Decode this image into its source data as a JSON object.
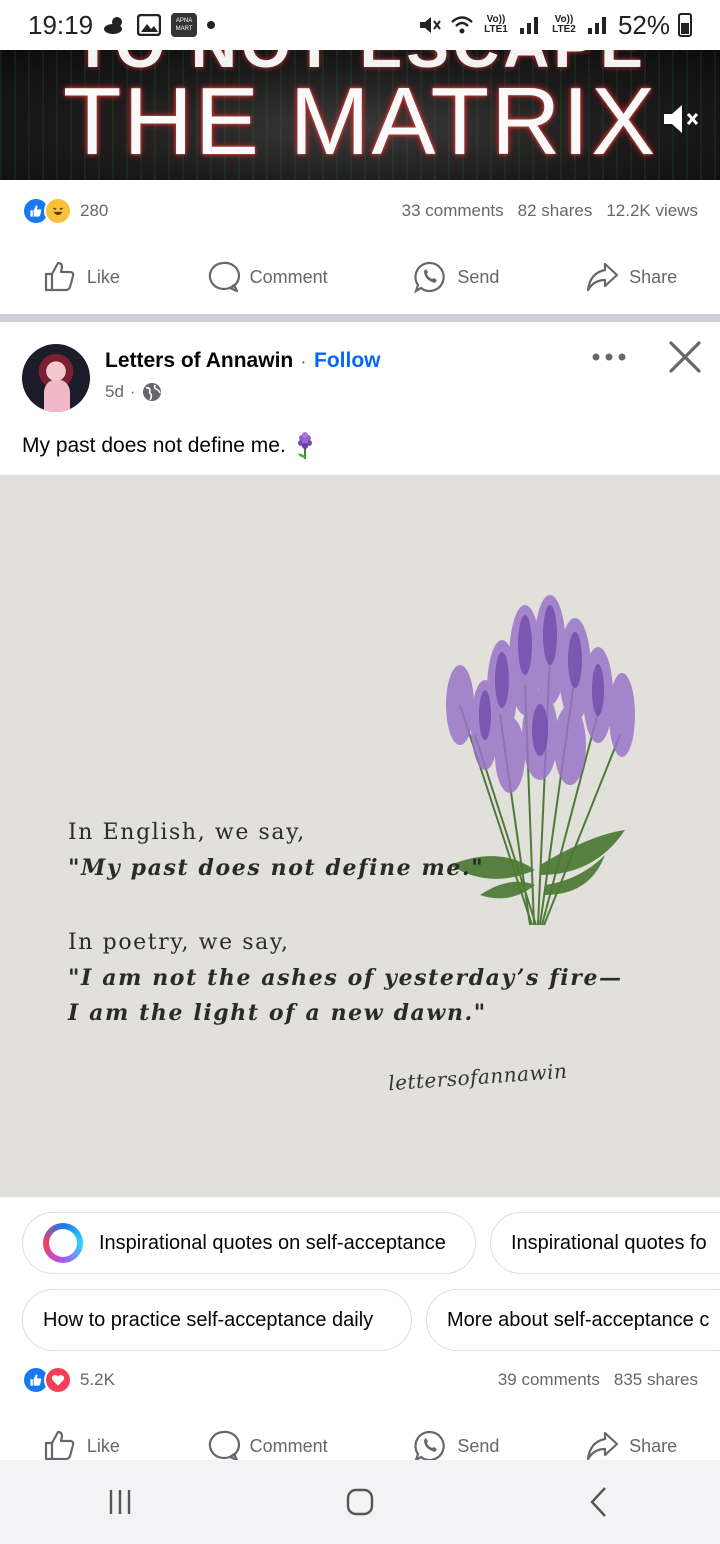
{
  "status_bar": {
    "time": "19:19",
    "app_badge": "APNA MART",
    "lte1": "Vo)) LTE1",
    "lte2": "Vo)) LTE2",
    "battery": "52%"
  },
  "video": {
    "title_top": "TO NOT ESCAPE",
    "title_main": "THE MATRIX"
  },
  "prev_post": {
    "reaction_count": "280",
    "comments": "33 comments",
    "shares": "82 shares",
    "views": "12.2K views"
  },
  "actions": {
    "like": "Like",
    "comment": "Comment",
    "send": "Send",
    "share": "Share"
  },
  "post": {
    "author": "Letters of Annawin",
    "separator": "·",
    "follow": "Follow",
    "age": "5d",
    "meta_sep": "·",
    "caption": "My past does not define me.",
    "image": {
      "line1": "In English, we say,",
      "line2": "\"My past does not define me.\"",
      "line3": "In poetry, we say,",
      "line4": "\"I am not the ashes of yesterday’s fire—",
      "line5": "I am the light of a new dawn.\"",
      "signature": "lettersofannawin"
    },
    "reaction_count": "5.2K",
    "comments": "39 comments",
    "shares": "835 shares"
  },
  "suggestions": [
    "Inspirational quotes on self-acceptance",
    "Inspirational quotes fo",
    "How to practice self-acceptance daily",
    "More about self-acceptance c"
  ],
  "colors": {
    "brand_blue": "#0866ff",
    "like_blue": "#1877f2",
    "love_red": "#f33e58",
    "haha_yellow": "#f7c23a",
    "image_bg": "#e1e0da"
  }
}
